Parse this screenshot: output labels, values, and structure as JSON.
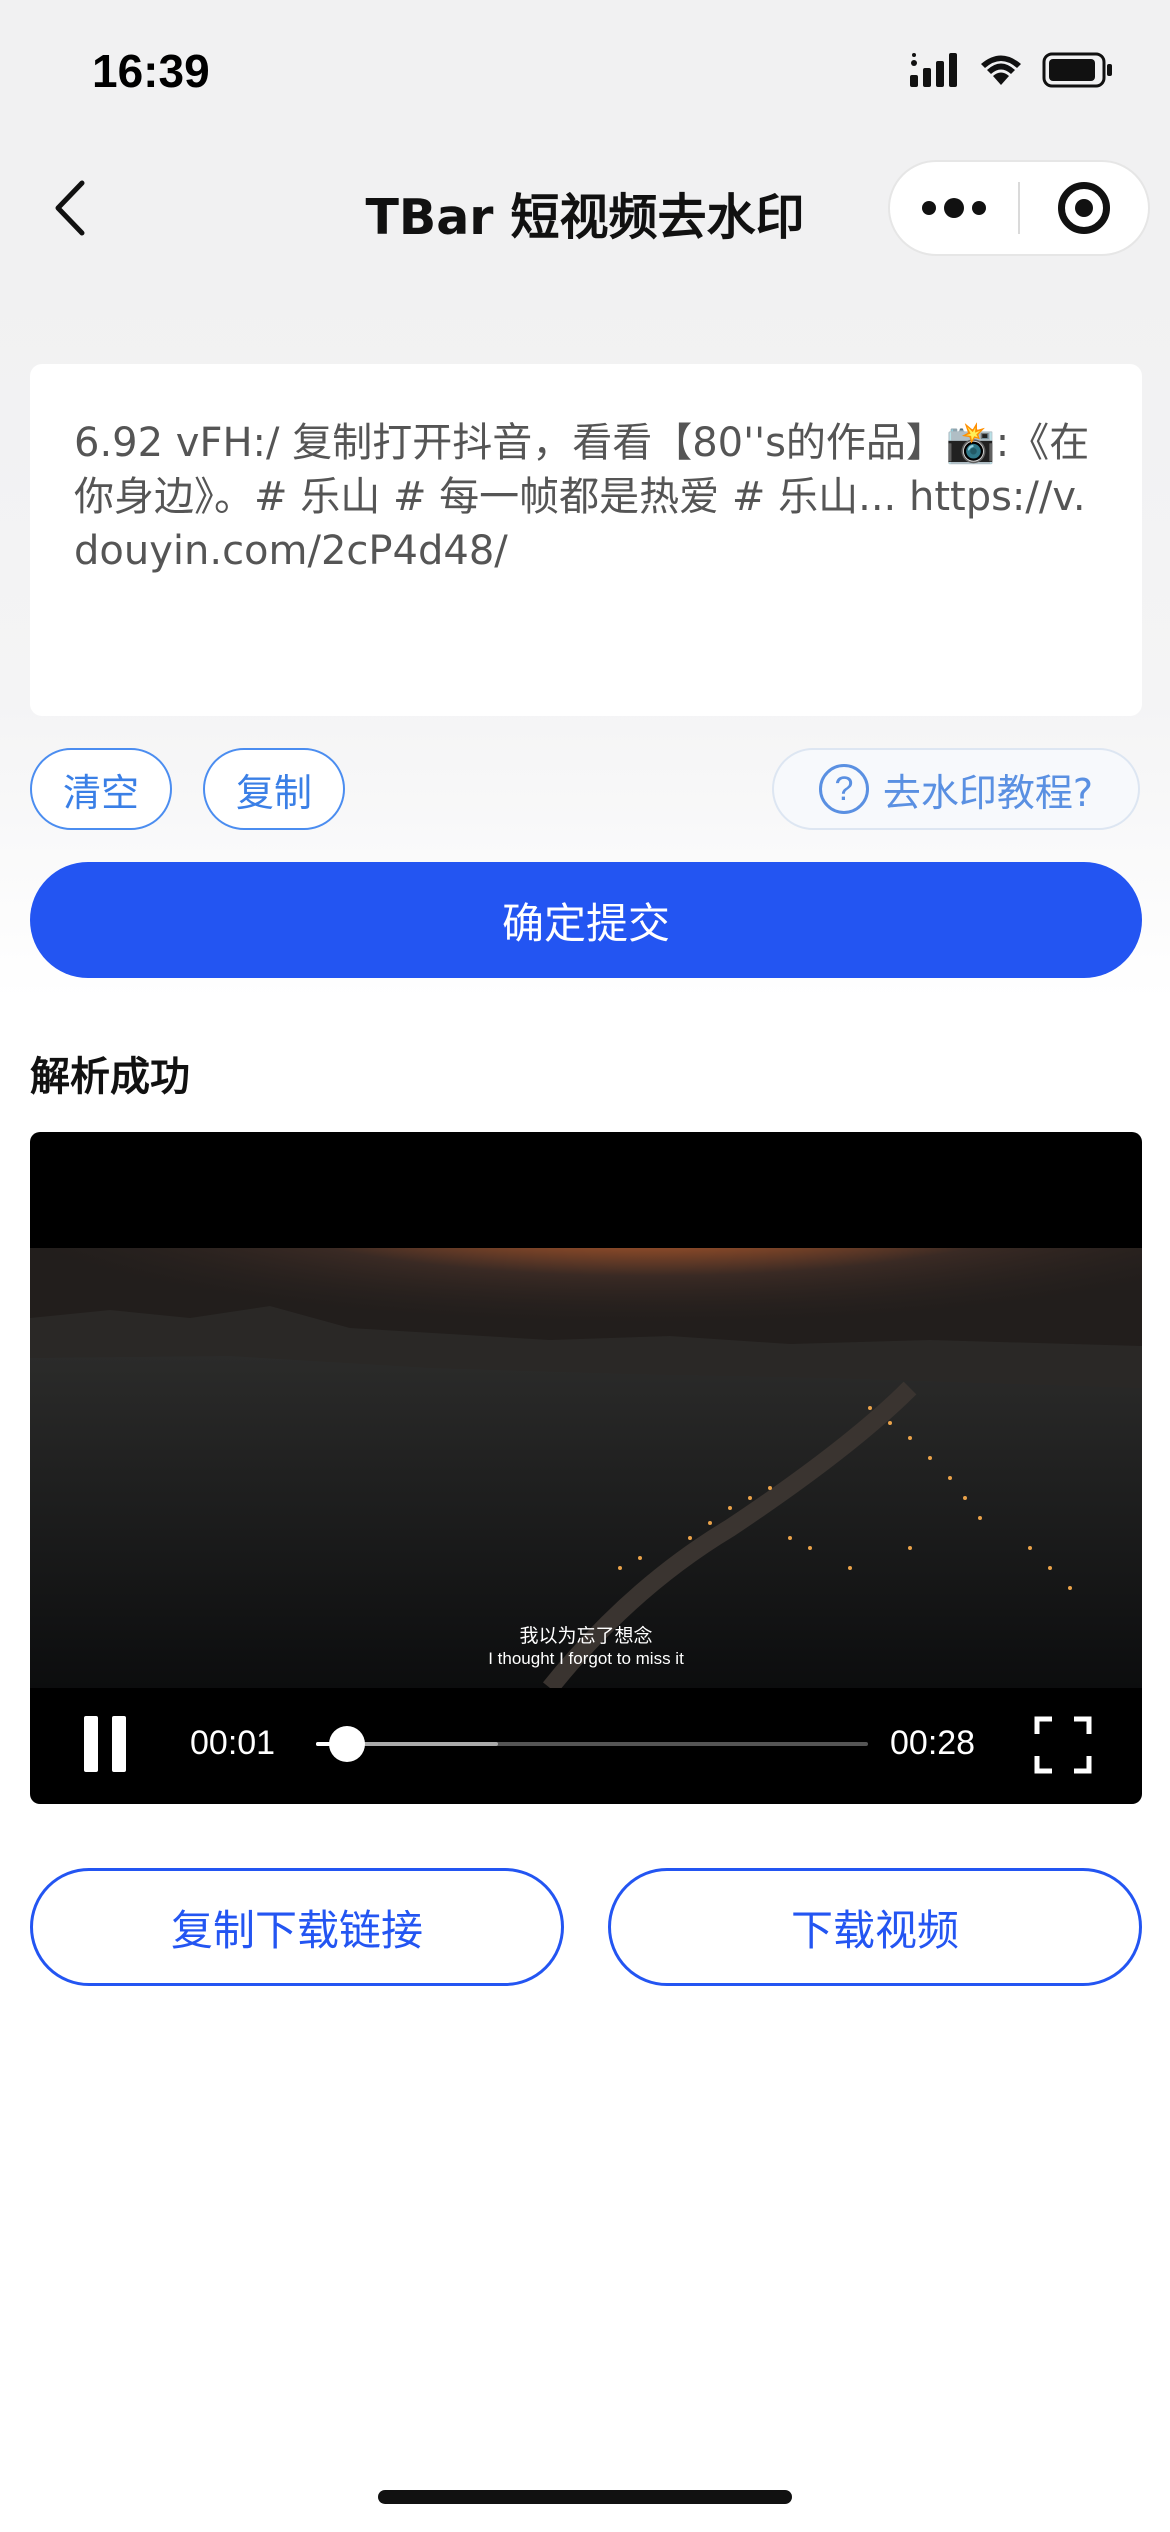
{
  "status_bar": {
    "time": "16:39"
  },
  "nav": {
    "title": "TBar 短视频去水印"
  },
  "input": {
    "text": "6.92 vFH:/ 复制打开抖音，看看【80''s的作品】📸:《在你身边》。# 乐山 # 每一帧都是热爱 # 乐山... https://v.douyin.com/2cP4d48/"
  },
  "actions": {
    "clear_label": "清空",
    "copy_label": "复制",
    "help_label": "去水印教程?",
    "help_glyph": "?"
  },
  "submit": {
    "label": "确定提交"
  },
  "result": {
    "title": "解析成功"
  },
  "video": {
    "subtitle_cn": "我以为忘了想念",
    "subtitle_en": "I thought I forgot to miss it",
    "current_time": "00:01",
    "total_time": "00:28",
    "progress": 0.03,
    "buffered": 0.33
  },
  "bottom": {
    "copy_link_label": "复制下载链接",
    "download_label": "下载视频"
  },
  "colors": {
    "primary": "#2355f2",
    "accent_light": "#4b8df0"
  },
  "icons": [
    "back-icon",
    "more-icon",
    "home-target-icon",
    "help-icon",
    "pause-icon",
    "fullscreen-icon"
  ]
}
